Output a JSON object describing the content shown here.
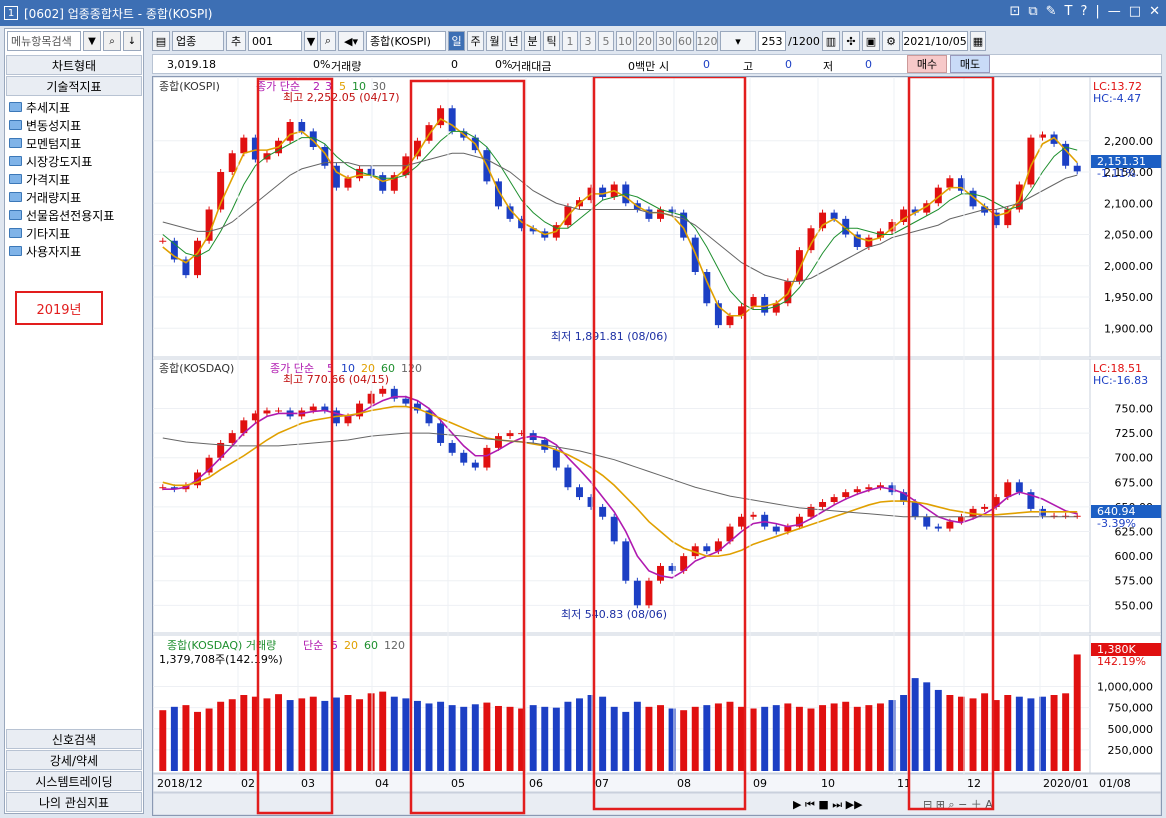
{
  "window": {
    "number": "1",
    "title": "[0602] 업종종합차트 - 종합(KOSPI)",
    "buttons": [
      "⊡",
      "⧉",
      "✎",
      "T",
      "?",
      "|",
      "—",
      "□",
      "✕"
    ]
  },
  "left_panel": {
    "search_placeholder": "메뉴항목검색",
    "chart_type_btn": "차트형태",
    "tech_btn": "기술적지표",
    "tree": [
      "추세지표",
      "변동성지표",
      "모멘텀지표",
      "시장강도지표",
      "가격지표",
      "거래량지표",
      "선물옵션전용지표",
      "기타지표",
      "사용자지표"
    ],
    "year_note": "2019년",
    "bottom": [
      "신호검색",
      "강세/약세",
      "시스템트레이딩",
      "나의 관심지표"
    ]
  },
  "toolbar": {
    "category": "업종",
    "add": "추",
    "code": "001",
    "name": "종합(KOSPI)",
    "periods": [
      "일",
      "주",
      "월",
      "년",
      "분",
      "틱"
    ],
    "selected_period": "일",
    "intervals": [
      "1",
      "3",
      "5",
      "10",
      "20",
      "30",
      "60",
      "120"
    ],
    "count": "253",
    "max_count": "/1200",
    "date": "2021/10/05"
  },
  "infobar": {
    "price": "3,019.18",
    "change": "0%",
    "volume_label": "거래량",
    "volume": "0",
    "vol_change": "0%",
    "amount_label": "거래대금",
    "amount": "0백만",
    "open_label": "시",
    "open": "0",
    "high_label": "고",
    "high": "0",
    "low_label": "저",
    "low": "0",
    "buy": "매수",
    "sell": "매도"
  },
  "chart_data": [
    {
      "type": "line",
      "title": "종합(KOSPI)",
      "legend": "종가 단순 2 3 5 10 30",
      "indicator_label": "종가 단순",
      "ma_periods": [
        "2",
        "3",
        "5",
        "10",
        "30"
      ],
      "lc": "LC:13.72",
      "hc": "HC:-4.47",
      "last_value": "2,151.31",
      "last_change": "-1.11%",
      "high_note": "최고 2,252.05 (04/17)",
      "low_note": "최저 1,891.81 (08/06)",
      "yticks": [
        2200,
        2150,
        2100,
        2050,
        2000,
        1950,
        1900
      ],
      "ylim": [
        1870,
        2270
      ],
      "close": [
        2040,
        2010,
        1985,
        2040,
        2090,
        2150,
        2180,
        2205,
        2170,
        2180,
        2200,
        2230,
        2215,
        2190,
        2160,
        2125,
        2140,
        2155,
        2145,
        2120,
        2145,
        2175,
        2200,
        2225,
        2252,
        2215,
        2205,
        2185,
        2135,
        2095,
        2075,
        2060,
        2055,
        2045,
        2065,
        2095,
        2105,
        2125,
        2110,
        2130,
        2100,
        2090,
        2075,
        2090,
        2085,
        2045,
        1990,
        1940,
        1905,
        1920,
        1935,
        1950,
        1925,
        1940,
        1975,
        2025,
        2060,
        2085,
        2075,
        2050,
        2030,
        2045,
        2055,
        2070,
        2090,
        2085,
        2100,
        2125,
        2140,
        2120,
        2095,
        2085,
        2065,
        2090,
        2130,
        2205,
        2210,
        2195,
        2160,
        2151
      ],
      "ma5": [
        2030,
        2015,
        2005,
        2020,
        2050,
        2100,
        2140,
        2180,
        2185,
        2185,
        2190,
        2210,
        2215,
        2200,
        2180,
        2150,
        2140,
        2145,
        2145,
        2135,
        2140,
        2155,
        2180,
        2210,
        2235,
        2225,
        2210,
        2195,
        2160,
        2120,
        2090,
        2070,
        2060,
        2050,
        2055,
        2080,
        2100,
        2115,
        2115,
        2120,
        2110,
        2095,
        2085,
        2085,
        2080,
        2060,
        2020,
        1975,
        1935,
        1920,
        1920,
        1935,
        1935,
        1940,
        1955,
        1995,
        2035,
        2065,
        2075,
        2060,
        2045,
        2040,
        2045,
        2060,
        2075,
        2085,
        2095,
        2110,
        2125,
        2125,
        2110,
        2095,
        2080,
        2085,
        2105,
        2160,
        2195,
        2205,
        2185,
        2165
      ],
      "ma10": [
        2050,
        2035,
        2020,
        2015,
        2025,
        2055,
        2090,
        2130,
        2160,
        2175,
        2185,
        2195,
        2205,
        2205,
        2195,
        2175,
        2160,
        2150,
        2145,
        2140,
        2140,
        2145,
        2160,
        2180,
        2200,
        2215,
        2215,
        2205,
        2190,
        2165,
        2135,
        2105,
        2085,
        2070,
        2060,
        2060,
        2075,
        2090,
        2105,
        2110,
        2115,
        2110,
        2100,
        2090,
        2085,
        2080,
        2060,
        2030,
        1995,
        1960,
        1940,
        1930,
        1930,
        1935,
        1945,
        1965,
        1990,
        2020,
        2045,
        2060,
        2060,
        2055,
        2050,
        2050,
        2060,
        2070,
        2080,
        2090,
        2105,
        2115,
        2115,
        2110,
        2100,
        2090,
        2095,
        2120,
        2150,
        2175,
        2190,
        2185
      ],
      "ma30": [
        2070,
        2065,
        2060,
        2055,
        2055,
        2060,
        2070,
        2085,
        2100,
        2115,
        2130,
        2145,
        2155,
        2160,
        2165,
        2165,
        2165,
        2160,
        2160,
        2160,
        2160,
        2160,
        2165,
        2170,
        2175,
        2180,
        2180,
        2175,
        2170,
        2160,
        2150,
        2135,
        2120,
        2110,
        2100,
        2095,
        2090,
        2090,
        2090,
        2090,
        2090,
        2090,
        2085,
        2085,
        2080,
        2075,
        2065,
        2050,
        2035,
        2020,
        2005,
        1995,
        1985,
        1980,
        1975,
        1975,
        1980,
        1990,
        2000,
        2010,
        2020,
        2030,
        2035,
        2045,
        2050,
        2055,
        2060,
        2065,
        2075,
        2080,
        2085,
        2090,
        2090,
        2095,
        2100,
        2110,
        2120,
        2130,
        2140,
        2145
      ]
    },
    {
      "type": "line",
      "title": "종합(KOSDAQ)",
      "legend": "종가 단순 5 10 20 60 120",
      "indicator_label": "종가 단순",
      "ma_periods": [
        "5",
        "10",
        "20",
        "60",
        "120"
      ],
      "lc": "LC:18.51",
      "hc": "HC:-16.83",
      "last_value": "640.94",
      "last_change": "-3.39%",
      "high_note": "최고 770.66 (04/15)",
      "low_note": "최저 540.83 (08/06)",
      "yticks": [
        750,
        725,
        700,
        675,
        650,
        625,
        600,
        575,
        550
      ],
      "ylim": [
        530,
        780
      ],
      "close": [
        670,
        668,
        672,
        685,
        700,
        715,
        725,
        738,
        745,
        748,
        748,
        742,
        748,
        752,
        748,
        735,
        742,
        755,
        765,
        770,
        760,
        755,
        748,
        735,
        715,
        705,
        695,
        690,
        710,
        722,
        725,
        725,
        718,
        708,
        690,
        670,
        660,
        650,
        640,
        615,
        575,
        550,
        575,
        590,
        585,
        600,
        610,
        605,
        615,
        630,
        640,
        642,
        630,
        625,
        630,
        640,
        650,
        655,
        660,
        665,
        668,
        670,
        672,
        665,
        655,
        640,
        630,
        628,
        635,
        640,
        648,
        650,
        660,
        675,
        665,
        648,
        641,
        641,
        641,
        641
      ],
      "ma5": [
        668,
        668,
        670,
        678,
        688,
        700,
        712,
        725,
        735,
        742,
        745,
        745,
        745,
        747,
        748,
        745,
        742,
        745,
        752,
        758,
        762,
        762,
        758,
        750,
        738,
        725,
        712,
        702,
        702,
        708,
        715,
        720,
        722,
        720,
        713,
        700,
        688,
        675,
        660,
        645,
        625,
        600,
        585,
        580,
        578,
        585,
        595,
        600,
        605,
        615,
        625,
        633,
        635,
        633,
        630,
        632,
        638,
        645,
        652,
        658,
        663,
        667,
        670,
        668,
        664,
        656,
        648,
        640,
        636,
        634,
        638,
        643,
        650,
        660,
        665,
        662,
        658,
        652,
        646,
        643
      ],
      "ma20": [
        675,
        672,
        672,
        675,
        680,
        688,
        695,
        702,
        710,
        718,
        725,
        730,
        735,
        738,
        740,
        742,
        743,
        745,
        748,
        750,
        752,
        752,
        750,
        745,
        740,
        735,
        730,
        725,
        720,
        718,
        717,
        716,
        714,
        712,
        708,
        703,
        697,
        690,
        682,
        672,
        660,
        648,
        635,
        625,
        615,
        608,
        604,
        600,
        600,
        602,
        606,
        612,
        616,
        620,
        624,
        628,
        632,
        636,
        640,
        644,
        648,
        652,
        655,
        656,
        656,
        655,
        653,
        650,
        647,
        645,
        643,
        642,
        642,
        643,
        644,
        645,
        645,
        645,
        645,
        645
      ],
      "ma120": [
        720,
        718,
        716,
        715,
        714,
        713,
        712,
        712,
        712,
        712,
        712,
        713,
        714,
        715,
        716,
        717,
        718,
        720,
        722,
        723,
        724,
        725,
        725,
        725,
        724,
        723,
        722,
        720,
        719,
        718,
        717,
        716,
        715,
        713,
        711,
        709,
        707,
        704,
        701,
        698,
        694,
        690,
        686,
        682,
        678,
        674,
        670,
        667,
        664,
        661,
        659,
        657,
        655,
        653,
        651,
        649,
        648,
        647,
        646,
        645,
        644,
        643,
        642,
        641,
        640,
        640,
        640,
        640,
        640,
        640,
        640,
        640,
        640,
        640,
        640,
        640,
        640,
        640,
        640,
        640
      ]
    },
    {
      "type": "bar",
      "title": "종합(KOSDAQ) 거래량",
      "legend": "단순 5 20 60 120",
      "indicator_label": "단순",
      "ma_periods": [
        "5",
        "20",
        "60",
        "120"
      ],
      "value_text": "1,379,708주(142.19%)",
      "last_value": "1,380K",
      "last_change": "142.19%",
      "yticks": [
        1000000,
        750000,
        500000,
        250000
      ],
      "ylim": [
        0,
        1350000
      ],
      "volume": [
        720,
        760,
        780,
        700,
        740,
        820,
        850,
        900,
        880,
        860,
        910,
        840,
        860,
        880,
        830,
        870,
        900,
        850,
        920,
        940,
        880,
        860,
        830,
        800,
        820,
        780,
        760,
        790,
        810,
        770,
        760,
        740,
        780,
        760,
        750,
        820,
        860,
        900,
        880,
        760,
        700,
        820,
        760,
        780,
        740,
        720,
        760,
        780,
        800,
        820,
        760,
        740,
        760,
        780,
        800,
        760,
        740,
        780,
        800,
        820,
        760,
        780,
        800,
        840,
        900,
        1100,
        1050,
        960,
        900,
        880,
        860,
        920,
        840,
        900,
        880,
        860,
        880,
        900,
        920,
        1380
      ]
    },
    {
      "type": "table",
      "x_axis_labels": [
        "2018/12",
        "02",
        "03",
        "04",
        "05",
        "06",
        "07",
        "08",
        "09",
        "10",
        "11",
        "12",
        "2020/01",
        "01/08"
      ]
    }
  ]
}
